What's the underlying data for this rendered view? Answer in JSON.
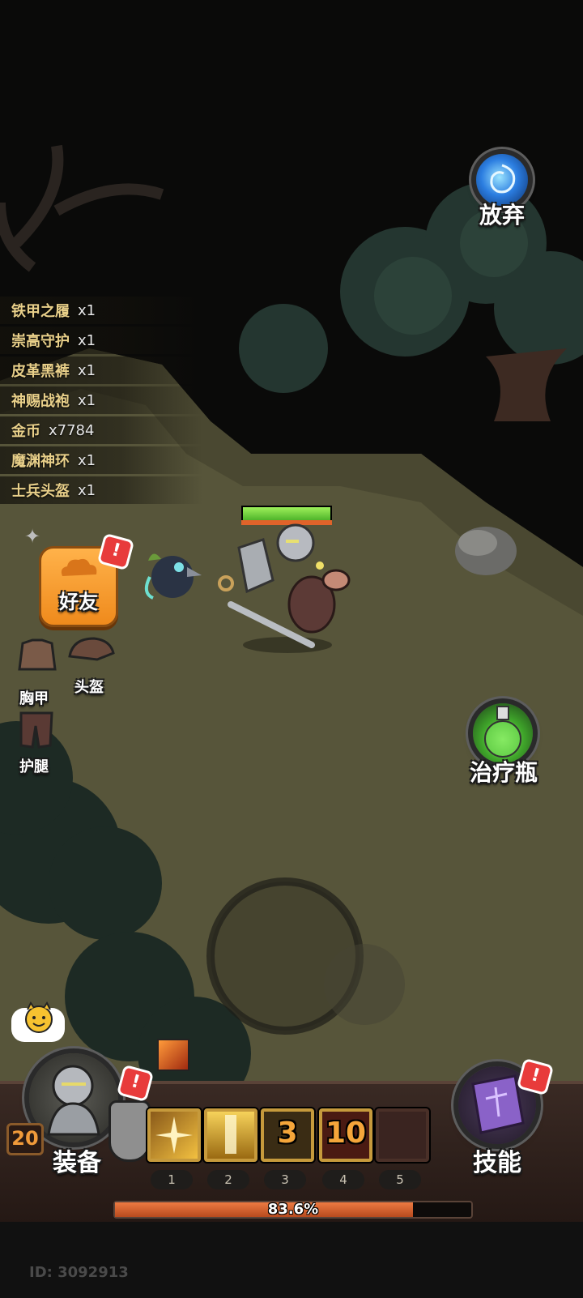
{
  "loot_log": [
    {
      "name": "铁甲之履",
      "count": "x1"
    },
    {
      "name": "崇高守护",
      "count": "x1"
    },
    {
      "name": "皮革黑裤",
      "count": "x1"
    },
    {
      "name": "神赐战袍",
      "count": "x1"
    },
    {
      "name": "金币",
      "count": "x7784"
    },
    {
      "name": "魔渊神环",
      "count": "x1"
    },
    {
      "name": "士兵头盔",
      "count": "x1"
    }
  ],
  "buttons": {
    "abandon": "放弃",
    "friends": "好友",
    "potion": "治疗瓶",
    "equipment": "装备",
    "skills": "技能",
    "alert_mark": "!"
  },
  "drops": {
    "chest": "胸甲",
    "helmet": "头盔",
    "legs": "护腿"
  },
  "player": {
    "level": "20",
    "health_fraction": 1.0
  },
  "skill_bar": {
    "slots": [
      {
        "num": "1",
        "cooldown": ""
      },
      {
        "num": "2",
        "cooldown": ""
      },
      {
        "num": "3",
        "cooldown": "3"
      },
      {
        "num": "4",
        "cooldown": "10"
      },
      {
        "num": "5",
        "cooldown": ""
      }
    ]
  },
  "experience": {
    "percent_text": "83.6%",
    "fraction": 0.836
  },
  "footer": {
    "id_text": "ID: 3092913"
  },
  "colors": {
    "ground": "#5a5737",
    "loot_name": "#e9d08a",
    "accent_orange": "#f29a2e",
    "health_green": "#6fd13b",
    "xp_fill": "#d2592b"
  }
}
